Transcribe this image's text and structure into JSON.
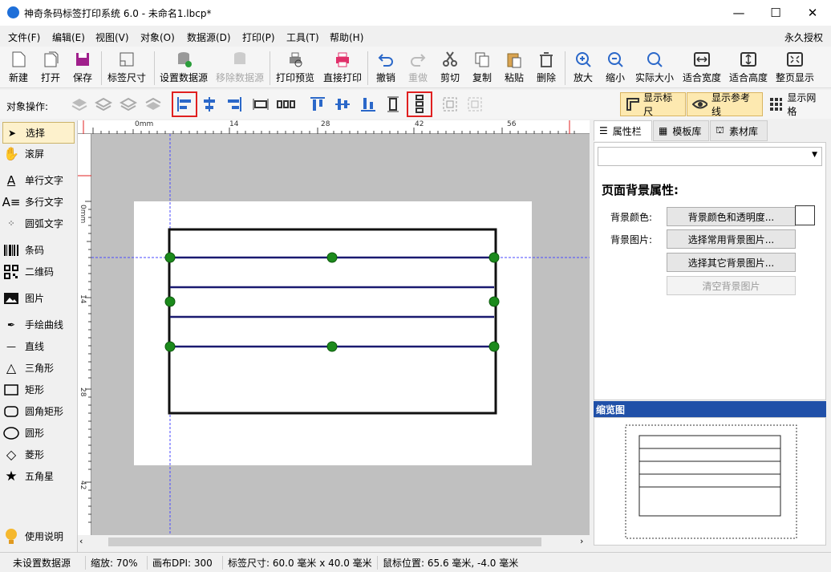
{
  "window": {
    "title": "神奇条码标签打印系统 6.0 - 未命名1.lbcp*",
    "min": "—",
    "max": "☐",
    "close": "✕"
  },
  "menu": {
    "items": [
      "文件(F)",
      "编辑(E)",
      "视图(V)",
      "对象(O)",
      "数据源(D)",
      "打印(P)",
      "工具(T)",
      "帮助(H)"
    ],
    "license": "永久授权"
  },
  "toolbar": {
    "new": "新建",
    "open": "打开",
    "save": "保存",
    "size": "标签尺寸",
    "setds": "设置数据源",
    "rmds": "移除数据源",
    "preview": "打印预览",
    "print": "直接打印",
    "undo": "撤销",
    "redo": "重做",
    "cut": "剪切",
    "copy": "复制",
    "paste": "粘贴",
    "delete": "删除",
    "zoomin": "放大",
    "zoomout": "缩小",
    "actual": "实际大小",
    "fitw": "适合宽度",
    "fith": "适合高度",
    "fitpage": "整页显示"
  },
  "objbar": {
    "label": "对象操作:",
    "ruler": "显示标尺",
    "guide": "显示参考线",
    "grid": "显示网格"
  },
  "tools": {
    "select": "选择",
    "pan": "滚屏",
    "text": "单行文字",
    "mtext": "多行文字",
    "arc": "圆弧文字",
    "barcode": "条码",
    "qr": "二维码",
    "image": "图片",
    "freehand": "手绘曲线",
    "line": "直线",
    "tri": "三角形",
    "rect": "矩形",
    "rrect": "圆角矩形",
    "circle": "圆形",
    "diamond": "菱形",
    "star": "五角星",
    "help": "使用说明"
  },
  "ruler": {
    "top": [
      "0mm",
      "14",
      "28",
      "42",
      "56"
    ],
    "left": [
      "0mm",
      "14",
      "28",
      "42"
    ]
  },
  "right": {
    "tabs": [
      "属性栏",
      "模板库",
      "素材库"
    ],
    "heading": "页面背景属性:",
    "bgcolor_label": "背景颜色:",
    "bgcolor_btn": "背景颜色和透明度...",
    "bgimg_label": "背景图片:",
    "common_btn": "选择常用背景图片...",
    "other_btn": "选择其它背景图片...",
    "clear_btn": "清空背景图片",
    "preview_title": "缩览图"
  },
  "status": {
    "ds": "未设置数据源",
    "zoom": "缩放: 70%",
    "dpi": "画布DPI: 300",
    "size": "标签尺寸: 60.0 毫米 x 40.0 毫米",
    "mouse": "鼠标位置: 65.6 毫米, -4.0 毫米"
  }
}
